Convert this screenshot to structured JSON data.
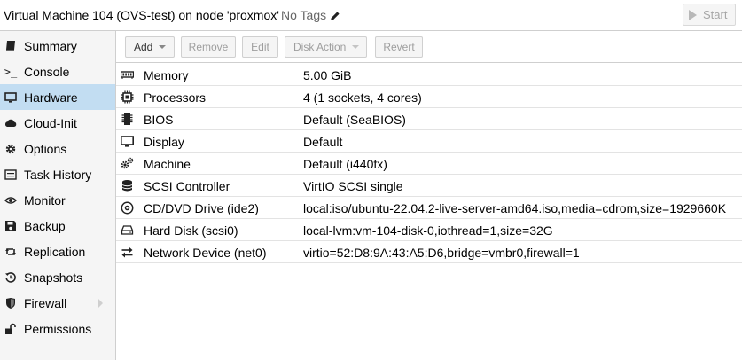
{
  "header": {
    "title": "Virtual Machine 104 (OVS-test) on node 'proxmox'",
    "tags": "No Tags",
    "tags_icon": "pencil-icon",
    "start_label": "Start",
    "start_icon": "play-icon"
  },
  "sidebar": {
    "items": [
      {
        "label": "Summary",
        "icon": "book-icon"
      },
      {
        "label": "Console",
        "icon": "terminal-icon"
      },
      {
        "label": "Hardware",
        "icon": "desktop-icon",
        "active": true
      },
      {
        "label": "Cloud-Init",
        "icon": "cloud-icon"
      },
      {
        "label": "Options",
        "icon": "gear-icon"
      },
      {
        "label": "Task History",
        "icon": "list-icon"
      },
      {
        "label": "Monitor",
        "icon": "eye-icon"
      },
      {
        "label": "Backup",
        "icon": "floppy-icon"
      },
      {
        "label": "Replication",
        "icon": "retweet-icon"
      },
      {
        "label": "Snapshots",
        "icon": "history-icon"
      },
      {
        "label": "Firewall",
        "icon": "shield-icon"
      },
      {
        "label": "Permissions",
        "icon": "unlock-icon"
      }
    ]
  },
  "toolbar": {
    "add_label": "Add",
    "remove_label": "Remove",
    "edit_label": "Edit",
    "disk_action_label": "Disk Action",
    "revert_label": "Revert"
  },
  "hardware": {
    "rows": [
      {
        "label": "Memory",
        "value": "5.00 GiB",
        "icon": "memory-icon"
      },
      {
        "label": "Processors",
        "value": "4 (1 sockets, 4 cores)",
        "icon": "cpu-icon"
      },
      {
        "label": "BIOS",
        "value": "Default (SeaBIOS)",
        "icon": "microchip-icon"
      },
      {
        "label": "Display",
        "value": "Default",
        "icon": "monitor-icon"
      },
      {
        "label": "Machine",
        "value": "Default (i440fx)",
        "icon": "cogs-icon"
      },
      {
        "label": "SCSI Controller",
        "value": "VirtIO SCSI single",
        "icon": "database-icon"
      },
      {
        "label": "CD/DVD Drive (ide2)",
        "value": "local:iso/ubuntu-22.04.2-live-server-amd64.iso,media=cdrom,size=1929660K",
        "icon": "cdrom-icon"
      },
      {
        "label": "Hard Disk (scsi0)",
        "value": "local-lvm:vm-104-disk-0,iothread=1,size=32G",
        "icon": "hdd-icon"
      },
      {
        "label": "Network Device (net0)",
        "value": "virtio=52:D8:9A:43:A5:D6,bridge=vmbr0,firewall=1",
        "icon": "exchange-icon"
      }
    ]
  }
}
